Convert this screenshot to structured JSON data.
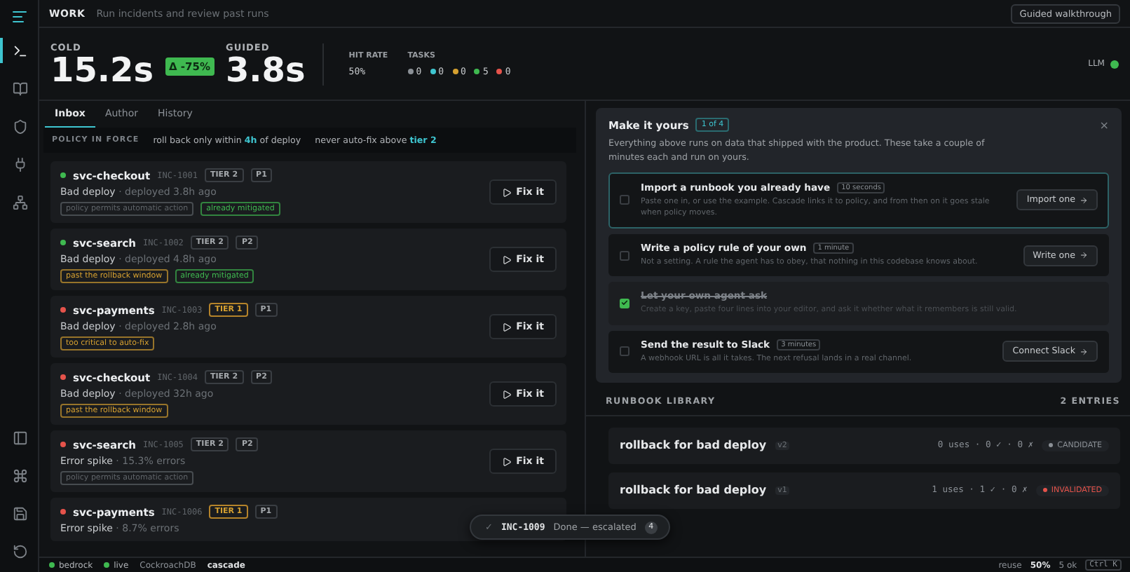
{
  "header": {
    "title": "WORK",
    "subtitle": "Run incidents and review past runs",
    "walkthrough": "Guided walkthrough"
  },
  "rail": [
    {
      "selected": true
    },
    {
      "selected": false
    },
    {
      "selected": false
    },
    {
      "selected": false
    },
    {
      "selected": false
    }
  ],
  "stats": {
    "cold_label": "COLD",
    "cold": "15.2s",
    "delta": "Δ -75%",
    "guided_label": "GUIDED",
    "guided": "3.8s",
    "hit_rate_label": "HIT RATE",
    "hit_rate": "50%",
    "tasks_label": "TASKS",
    "tasks": [
      {
        "color": "#8b9096",
        "count": "0"
      },
      {
        "color": "#3ec5d0",
        "count": "0"
      },
      {
        "color": "#d6a030",
        "count": "0"
      },
      {
        "color": "#3fb950",
        "count": "5"
      },
      {
        "color": "#e5534b",
        "count": "0"
      }
    ],
    "llm_label": "LLM",
    "llm_on": true
  },
  "tabs": [
    {
      "label": "Inbox",
      "selected": true
    },
    {
      "label": "Author",
      "selected": false
    },
    {
      "label": "History",
      "selected": false
    }
  ],
  "policy": {
    "label": "POLICY IN FORCE",
    "rules": [
      "roll back only within **4h** of deploy",
      "never auto-fix above **tier 2**"
    ]
  },
  "incidents": [
    {
      "color": "#3fb950",
      "service": "svc-checkout",
      "id": "INC-1001",
      "tier": "TIER 2",
      "critical": false,
      "priority": "P1",
      "kind": "Bad deploy",
      "detail": "· deployed 3.8h ago",
      "tags": [
        {
          "text": "policy permits automatic action",
          "color": "#5f6469"
        },
        {
          "text": "already mitigated",
          "color": "#3fb950"
        }
      ],
      "action": "Fix it"
    },
    {
      "color": "#3fb950",
      "service": "svc-search",
      "id": "INC-1002",
      "tier": "TIER 2",
      "critical": false,
      "priority": "P2",
      "kind": "Bad deploy",
      "detail": "· deployed 4.8h ago",
      "tags": [
        {
          "text": "past the rollback window",
          "color": "#d6a030"
        },
        {
          "text": "already mitigated",
          "color": "#3fb950"
        }
      ],
      "action": "Fix it"
    },
    {
      "color": "#e5534b",
      "service": "svc-payments",
      "id": "INC-1003",
      "tier": "TIER 1",
      "critical": true,
      "priority": "P1",
      "kind": "Bad deploy",
      "detail": "· deployed 2.8h ago",
      "tags": [
        {
          "text": "too critical to auto-fix",
          "color": "#d6a030"
        }
      ],
      "action": "Fix it"
    },
    {
      "color": "#e5534b",
      "service": "svc-checkout",
      "id": "INC-1004",
      "tier": "TIER 2",
      "critical": false,
      "priority": "P2",
      "kind": "Bad deploy",
      "detail": "· deployed 32h ago",
      "tags": [
        {
          "text": "past the rollback window",
          "color": "#d6a030"
        }
      ],
      "action": "Fix it"
    },
    {
      "color": "#e5534b",
      "service": "svc-search",
      "id": "INC-1005",
      "tier": "TIER 2",
      "critical": false,
      "priority": "P2",
      "kind": "Error spike",
      "detail": "· 15.3% errors",
      "tags": [
        {
          "text": "policy permits automatic action",
          "color": "#5f6469"
        }
      ],
      "action": "Fix it"
    },
    {
      "color": "#e5534b",
      "service": "svc-payments",
      "id": "INC-1006",
      "tier": "TIER 1",
      "critical": true,
      "priority": "P1",
      "kind": "Error spike",
      "detail": "· 8.7% errors"
    }
  ],
  "onboarding": {
    "title": "Make it yours",
    "step": "1 of 4",
    "close": "×",
    "intro": "Everything above runs on data that shipped with the product. These take a couple of minutes each and run on yours.",
    "steps": [
      {
        "title": "Import a runbook you already have",
        "time": "10 seconds",
        "text": "Paste one in, or use the example. Cascade links it to policy, and from then on it goes stale when policy moves.",
        "button": "Import one",
        "checked": false,
        "active": true
      },
      {
        "title": "Write a policy rule of your own",
        "time": "1 minute",
        "text": "Not a setting. A rule the agent has to obey, that nothing in this codebase knows about.",
        "button": "Write one",
        "checked": false,
        "active": false
      },
      {
        "title": "Let your own agent ask",
        "text": "Create a key, paste four lines into your editor, and ask it whether what it remembers is still valid.",
        "checked": true,
        "active": false
      },
      {
        "title": "Send the result to Slack",
        "time": "3 minutes",
        "text": "A webhook URL is all it takes. The next refusal lands in a real channel.",
        "button": "Connect Slack",
        "checked": false,
        "active": false
      }
    ]
  },
  "library": {
    "title": "RUNBOOK LIBRARY",
    "count": "2 ENTRIES",
    "entries": [
      {
        "name": "rollback for bad deploy",
        "version": "v2",
        "stats": "0 uses · 0 ✓ · 0 ✗",
        "state": "CANDIDATE",
        "color": "#8b9096"
      },
      {
        "name": "rollback for bad deploy",
        "version": "v1",
        "stats": "1 uses · 1 ✓ · 0 ✗",
        "state": "INVALIDATED",
        "color": "#e5534b"
      }
    ]
  },
  "toast": {
    "icon": "✓",
    "id": "INC-1009",
    "text": "Done — escalated",
    "count": "4"
  },
  "status_bar": {
    "items": [
      {
        "text": "bedrock",
        "color": "#3fb950"
      },
      {
        "text": "live",
        "color": "#3fb950"
      }
    ],
    "db": "CockroachDB",
    "app": "cascade",
    "reuse_label": "reuse",
    "reuse": "50%",
    "ok": "5 ok",
    "shortcut": "Ctrl K"
  }
}
